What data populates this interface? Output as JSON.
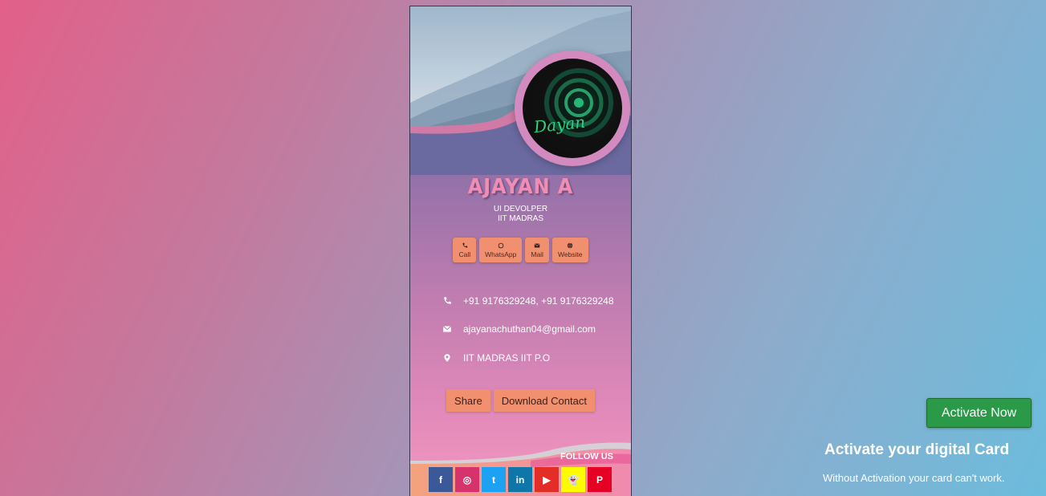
{
  "profile": {
    "name": "AJAYAN A",
    "role_line1": "UI DEVOLPER",
    "role_line2": "IIT MADRAS",
    "avatar_text": "Dayan"
  },
  "quick_actions": [
    {
      "label": "Call",
      "icon": "phone-icon"
    },
    {
      "label": "WhatsApp",
      "icon": "whatsapp-icon"
    },
    {
      "label": "Mail",
      "icon": "mail-icon"
    },
    {
      "label": "Website",
      "icon": "globe-icon"
    }
  ],
  "contact": {
    "phone": "+91 9176329248, +91 9176329248",
    "email": "ajayanachuthan04@gmail.com",
    "address": "IIT MADRAS IIT P.O"
  },
  "actions": {
    "share": "Share",
    "download": "Download Contact"
  },
  "footer": {
    "follow_label": "FOLLOW US",
    "socials": [
      {
        "name": "facebook",
        "glyph": "f",
        "color": "#3b5998"
      },
      {
        "name": "instagram",
        "glyph": "◎",
        "color": "#d6336c"
      },
      {
        "name": "twitter",
        "glyph": "t",
        "color": "#1da1f2"
      },
      {
        "name": "linkedin",
        "glyph": "in",
        "color": "#0e76a8"
      },
      {
        "name": "youtube",
        "glyph": "▶",
        "color": "#e52d27"
      },
      {
        "name": "snapchat",
        "glyph": "👻",
        "color": "#fffc00"
      },
      {
        "name": "pinterest",
        "glyph": "P",
        "color": "#e60023"
      }
    ]
  },
  "activation": {
    "button": "Activate Now",
    "title": "Activate your digital Card",
    "subtitle": "Without Activation your card can't work."
  },
  "colors": {
    "accent_orange": "#f0906e",
    "name_pink": "#f08db3",
    "activate_green": "#2a9a48"
  }
}
